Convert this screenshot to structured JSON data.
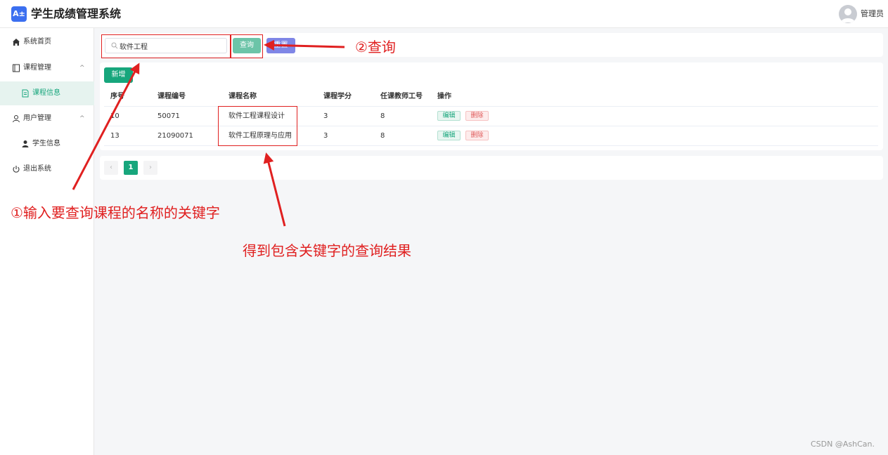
{
  "header": {
    "logo_text": "A±",
    "title": "学生成绩管理系统",
    "user": "管理员"
  },
  "sidebar": {
    "items": [
      {
        "label": "系统首页",
        "icon": "home-icon"
      },
      {
        "label": "课程管理",
        "icon": "book-icon",
        "chevron": "^"
      },
      {
        "label": "课程信息",
        "icon": "document-icon",
        "active": true
      },
      {
        "label": "用户管理",
        "icon": "user-outline-icon",
        "chevron": "^"
      },
      {
        "label": "学生信息",
        "icon": "user-solid-icon"
      },
      {
        "label": "退出系统",
        "icon": "power-icon"
      }
    ]
  },
  "search": {
    "value": "软件工程",
    "query_label": "查询",
    "reset_label": "重置"
  },
  "toolbar": {
    "add_label": "新增"
  },
  "table": {
    "columns": [
      "序号",
      "课程编号",
      "课程名称",
      "课程学分",
      "任课教师工号",
      "操作"
    ],
    "rows": [
      {
        "id": "10",
        "code": "50071",
        "name": "软件工程课程设计",
        "credit": "3",
        "teacher": "8"
      },
      {
        "id": "13",
        "code": "21090071",
        "name": "软件工程原理与应用",
        "credit": "3",
        "teacher": "8"
      }
    ],
    "edit_label": "编辑",
    "delete_label": "删除"
  },
  "pagination": {
    "prev": "‹",
    "current": "1",
    "next": "›"
  },
  "annotations": {
    "step1": "①输入要查询课程的名称的关键字",
    "step2": "②查询",
    "result": "得到包含关键字的查询结果",
    "color": "#e02020"
  },
  "watermark": "CSDN @AshCan.",
  "colors": {
    "primary": "#17a67c",
    "reset": "#7f86e6"
  }
}
